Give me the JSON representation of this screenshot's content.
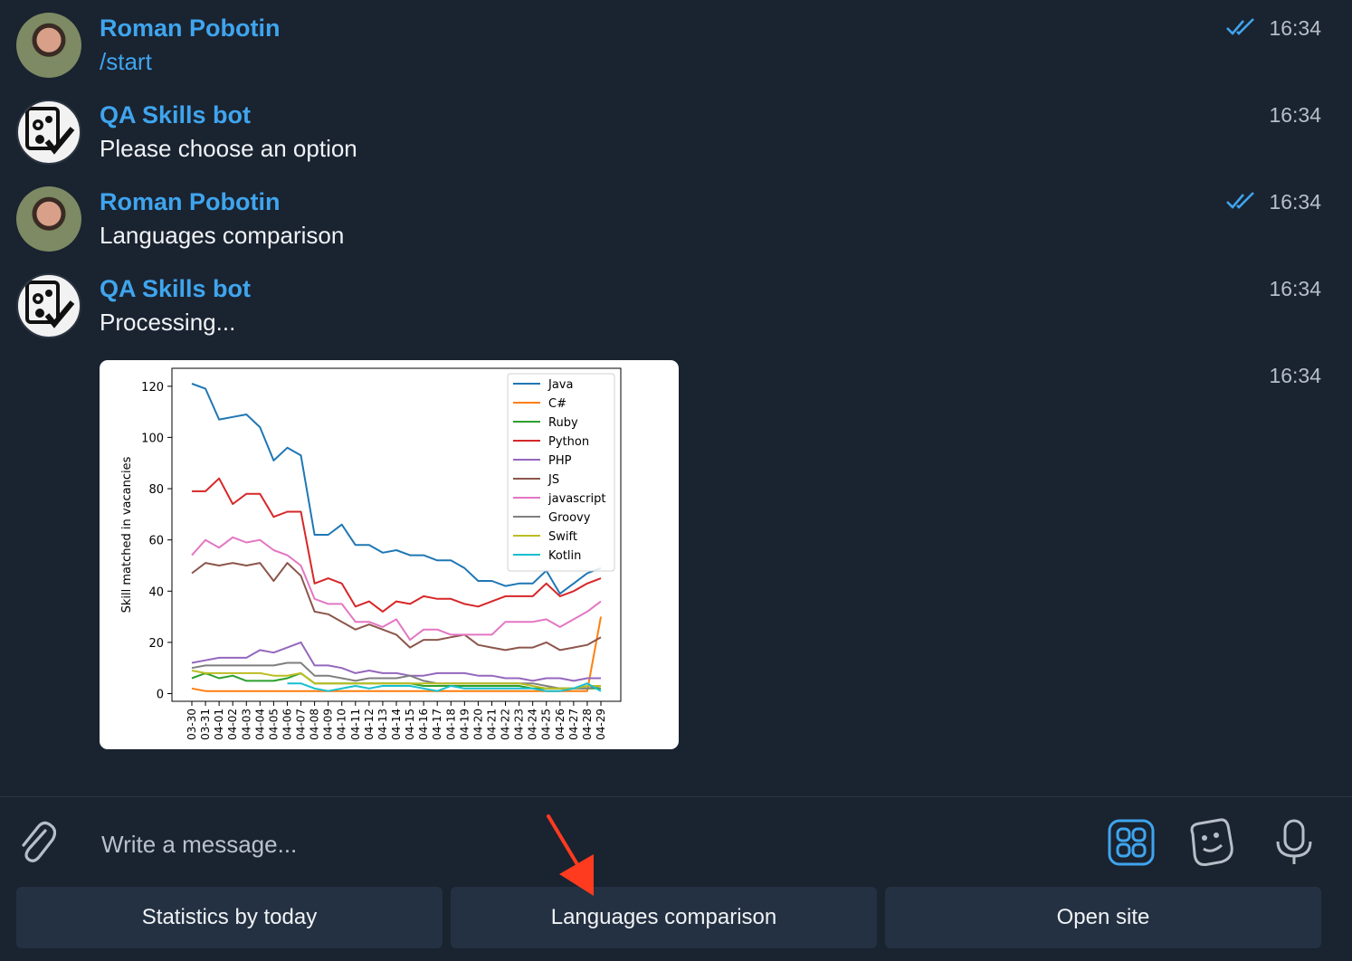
{
  "messages": [
    {
      "sender": "Roman Pobotin",
      "text": "/start",
      "time": "16:34",
      "avatar": "user-avatar",
      "read": true
    },
    {
      "sender": "QA Skills bot",
      "text": "Please choose an option",
      "time": "16:34",
      "avatar": "bot-avatar",
      "read": false
    },
    {
      "sender": "Roman Pobotin",
      "text": "Languages comparison",
      "time": "16:34",
      "avatar": "user-avatar",
      "read": true
    },
    {
      "sender": "QA Skills bot",
      "text": "Processing...",
      "time": "16:34",
      "avatar": "bot-avatar",
      "read": false
    }
  ],
  "image_message": {
    "time": "16:34"
  },
  "chart_data": {
    "type": "line",
    "ylabel": "Skill matched in vacancies",
    "xlabel": "",
    "ylim": [
      -3,
      127
    ],
    "yticks": [
      0,
      20,
      40,
      60,
      80,
      100,
      120
    ],
    "legend_position": "top-right",
    "x": [
      "03-30",
      "03-31",
      "04-01",
      "04-02",
      "04-03",
      "04-04",
      "04-05",
      "04-06",
      "04-07",
      "04-08",
      "04-09",
      "04-10",
      "04-11",
      "04-12",
      "04-13",
      "04-14",
      "04-15",
      "04-16",
      "04-17",
      "04-18",
      "04-19",
      "04-20",
      "04-21",
      "04-22",
      "04-23",
      "04-24",
      "04-25",
      "04-26",
      "04-27",
      "04-28",
      "04-29"
    ],
    "series": [
      {
        "name": "Java",
        "color": "#1f77b4",
        "values": [
          121,
          119,
          107,
          108,
          109,
          104,
          91,
          96,
          93,
          62,
          62,
          66,
          58,
          58,
          55,
          56,
          54,
          54,
          52,
          52,
          49,
          44,
          44,
          42,
          43,
          43,
          48,
          39,
          43,
          47,
          49
        ]
      },
      {
        "name": "C#",
        "color": "#ff7f0e",
        "values": [
          2,
          1,
          1,
          1,
          1,
          1,
          1,
          1,
          1,
          1,
          1,
          1,
          1,
          1,
          1,
          1,
          1,
          1,
          1,
          1,
          1,
          1,
          1,
          1,
          1,
          1,
          1,
          1,
          1,
          1,
          30
        ]
      },
      {
        "name": "Ruby",
        "color": "#2ca02c",
        "values": [
          6,
          8,
          6,
          7,
          5,
          5,
          5,
          6,
          8,
          4,
          4,
          4,
          4,
          4,
          4,
          4,
          4,
          3,
          3,
          3,
          3,
          3,
          3,
          3,
          3,
          2,
          2,
          2,
          2,
          2,
          2
        ]
      },
      {
        "name": "Python",
        "color": "#d62728",
        "values": [
          79,
          79,
          84,
          74,
          78,
          78,
          69,
          71,
          71,
          43,
          45,
          43,
          34,
          36,
          32,
          36,
          35,
          38,
          37,
          37,
          35,
          34,
          36,
          38,
          38,
          38,
          43,
          38,
          40,
          43,
          45
        ]
      },
      {
        "name": "PHP",
        "color": "#9467bd",
        "values": [
          12,
          13,
          14,
          14,
          14,
          17,
          16,
          18,
          20,
          11,
          11,
          10,
          8,
          9,
          8,
          8,
          7,
          7,
          8,
          8,
          8,
          7,
          7,
          6,
          6,
          5,
          6,
          6,
          5,
          6,
          6
        ]
      },
      {
        "name": "JS",
        "color": "#8c564b",
        "values": [
          47,
          51,
          50,
          51,
          50,
          51,
          44,
          51,
          46,
          32,
          31,
          28,
          25,
          27,
          25,
          23,
          18,
          21,
          21,
          22,
          23,
          19,
          18,
          17,
          18,
          18,
          20,
          17,
          18,
          19,
          22
        ]
      },
      {
        "name": "javascript",
        "color": "#e377c2",
        "values": [
          54,
          60,
          57,
          61,
          59,
          60,
          56,
          54,
          50,
          37,
          35,
          35,
          28,
          28,
          26,
          29,
          21,
          25,
          25,
          23,
          23,
          23,
          23,
          28,
          28,
          28,
          29,
          26,
          29,
          32,
          36
        ]
      },
      {
        "name": "Groovy",
        "color": "#7f7f7f",
        "values": [
          10,
          11,
          11,
          11,
          11,
          11,
          11,
          12,
          12,
          7,
          7,
          6,
          5,
          6,
          6,
          6,
          7,
          5,
          4,
          4,
          4,
          4,
          4,
          4,
          4,
          4,
          3,
          2,
          2,
          2,
          3
        ]
      },
      {
        "name": "Swift",
        "color": "#bcbd22",
        "values": [
          9,
          8,
          8,
          8,
          8,
          8,
          7,
          7,
          8,
          4,
          4,
          4,
          4,
          4,
          4,
          4,
          4,
          4,
          4,
          4,
          4,
          4,
          4,
          4,
          4,
          3,
          2,
          2,
          2,
          3,
          3
        ]
      },
      {
        "name": "Kotlin",
        "color": "#17becf",
        "values": [
          null,
          null,
          null,
          null,
          null,
          null,
          null,
          4,
          4,
          2,
          1,
          2,
          3,
          2,
          3,
          3,
          3,
          2,
          1,
          3,
          2,
          2,
          2,
          2,
          2,
          2,
          1,
          1,
          2,
          4,
          1
        ]
      }
    ]
  },
  "composer": {
    "placeholder": "Write a message..."
  },
  "keyboard": {
    "buttons": [
      "Statistics by today",
      "Languages comparison",
      "Open site"
    ]
  },
  "colors": {
    "accent": "#3fa5ee",
    "background": "#1a2330",
    "button": "#243142",
    "annotation_arrow": "#ff3b1f"
  }
}
